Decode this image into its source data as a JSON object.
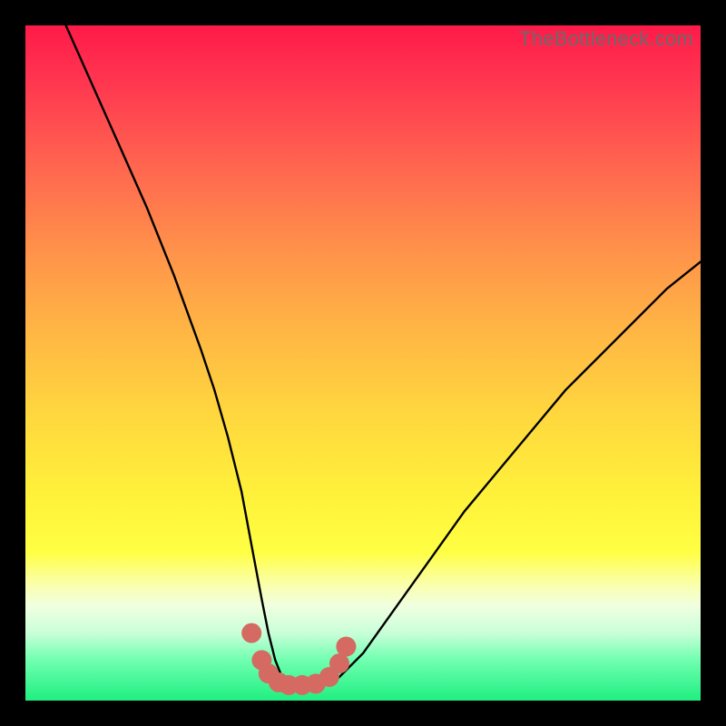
{
  "watermark": "TheBottleneck.com",
  "chart_data": {
    "type": "line",
    "title": "",
    "xlabel": "",
    "ylabel": "",
    "xlim": [
      0,
      100
    ],
    "ylim": [
      0,
      100
    ],
    "series": [
      {
        "name": "bottleneck-curve",
        "x": [
          6,
          10,
          14,
          18,
          22,
          26,
          28,
          30,
          32,
          33.5,
          35,
          36,
          37,
          38,
          39,
          40,
          42,
          44,
          46,
          50,
          55,
          60,
          65,
          70,
          75,
          80,
          85,
          90,
          95,
          100
        ],
        "values": [
          100,
          91,
          82,
          73,
          63,
          52,
          46,
          39,
          31,
          23,
          15,
          10,
          6,
          3.5,
          2.5,
          2.2,
          2.1,
          2.2,
          3,
          7,
          14,
          21,
          28,
          34,
          40,
          46,
          51,
          56,
          61,
          65
        ]
      },
      {
        "name": "marker-ring",
        "x": [
          33.5,
          35,
          36,
          37.5,
          39,
          41,
          43,
          45,
          46.5,
          47.5
        ],
        "values": [
          10,
          6,
          4,
          2.7,
          2.3,
          2.3,
          2.5,
          3.5,
          5.5,
          8
        ]
      }
    ],
    "colors": {
      "curve": "#000000",
      "markers": "#d46a62"
    }
  }
}
